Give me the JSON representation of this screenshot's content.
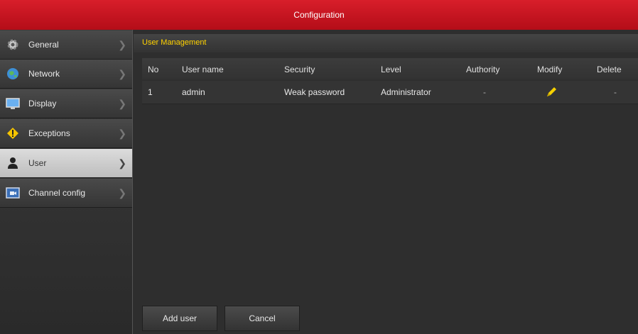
{
  "window": {
    "title": "Configuration"
  },
  "sidebar": {
    "items": [
      {
        "label": "General",
        "icon": "gear-icon"
      },
      {
        "label": "Network",
        "icon": "globe-icon"
      },
      {
        "label": "Display",
        "icon": "monitor-icon"
      },
      {
        "label": "Exceptions",
        "icon": "warning-icon"
      },
      {
        "label": "User",
        "icon": "user-icon",
        "active": true
      },
      {
        "label": "Channel config",
        "icon": "camera-channel-icon"
      }
    ]
  },
  "main": {
    "section_title": "User Management",
    "table": {
      "headers": [
        "No",
        "User name",
        "Security",
        "Level",
        "Authority",
        "Modify",
        "Delete"
      ],
      "rows": [
        {
          "no": "1",
          "username": "admin",
          "security": "Weak password",
          "level": "Administrator",
          "authority": "-",
          "modify": "pencil-icon",
          "delete": "-"
        }
      ]
    },
    "buttons": {
      "add_user": "Add user",
      "cancel": "Cancel"
    }
  },
  "colors": {
    "titlebar": "#c8101c",
    "section_title": "#ffd200",
    "edit_icon": "#f5d000"
  }
}
